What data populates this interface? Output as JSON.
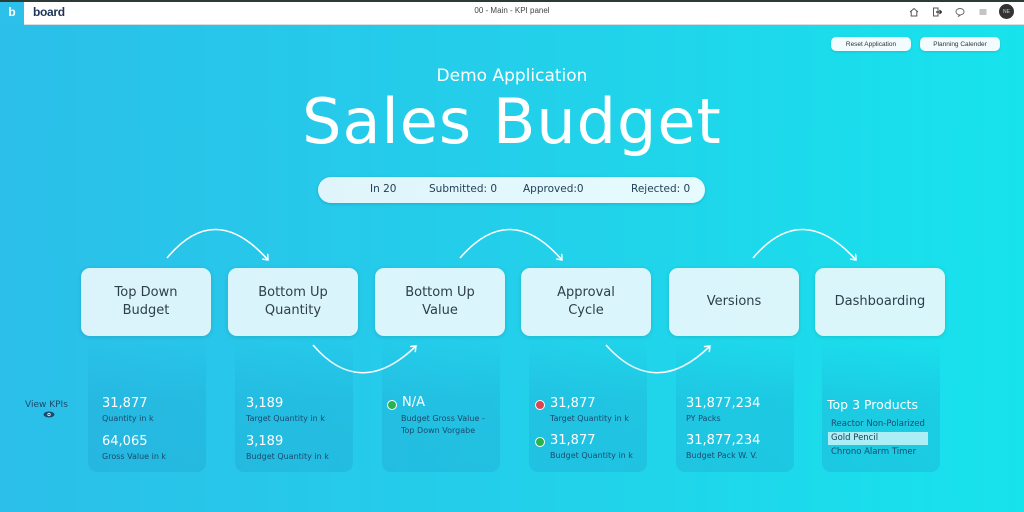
{
  "topbar": {
    "logo_letter": "b",
    "brand": "board",
    "window_title": "00 - Main - KPI panel",
    "icons": [
      "home-icon",
      "exit-icon",
      "chat-icon",
      "menu-icon"
    ],
    "avatar_initials": "NE"
  },
  "actions": {
    "reset_label": "Reset Application",
    "calendar_label": "Planning Calender"
  },
  "header": {
    "subtitle": "Demo Application",
    "title": "Sales Budget"
  },
  "status": {
    "in": "In  20",
    "submitted": "Submitted:  0",
    "approved": "Approved:0",
    "rejected": "Rejected:  0"
  },
  "steps": [
    {
      "label": "Top Down\nBudget"
    },
    {
      "label": "Bottom Up\nQuantity"
    },
    {
      "label": "Bottom Up\nValue"
    },
    {
      "label": "Approval\nCycle"
    },
    {
      "label": "Versions"
    },
    {
      "label": "Dashboarding"
    }
  ],
  "view_kpis_label": "View KPIs",
  "kpis": {
    "top_down": [
      {
        "value": "31,877",
        "label": "Quantity in k"
      },
      {
        "value": "64,065",
        "label": "Gross Value in k"
      }
    ],
    "bottom_up_quantity": [
      {
        "value": "3,189",
        "label": "Target Quantity in k"
      },
      {
        "value": "3,189",
        "label": "Budget Quantity in k"
      }
    ],
    "bottom_up_value": [
      {
        "value": "N/A",
        "label": "Budget Gross Value -",
        "label2": "Top Down Vorgabe",
        "status": "green"
      }
    ],
    "approval": [
      {
        "value": "31,877",
        "label": "Target Quantity in k",
        "status": "red"
      },
      {
        "value": "31,877",
        "label": "Budget Quantity in k",
        "status": "green"
      }
    ],
    "versions": [
      {
        "value": "31,877,234",
        "label": "PY Packs"
      },
      {
        "value": "31,877,234",
        "label": "Budget Pack W. V."
      }
    ],
    "dashboarding": {
      "title": "Top 3 Products",
      "items": [
        "Reactor Non-Polarized",
        "Gold Pencil",
        "Chrono Alarm Timer"
      ],
      "selected": "Gold Pencil"
    }
  },
  "colors": {
    "status_green": "#29b34a",
    "status_red": "#d94555",
    "brand_cyan": "#2cc0ea"
  }
}
